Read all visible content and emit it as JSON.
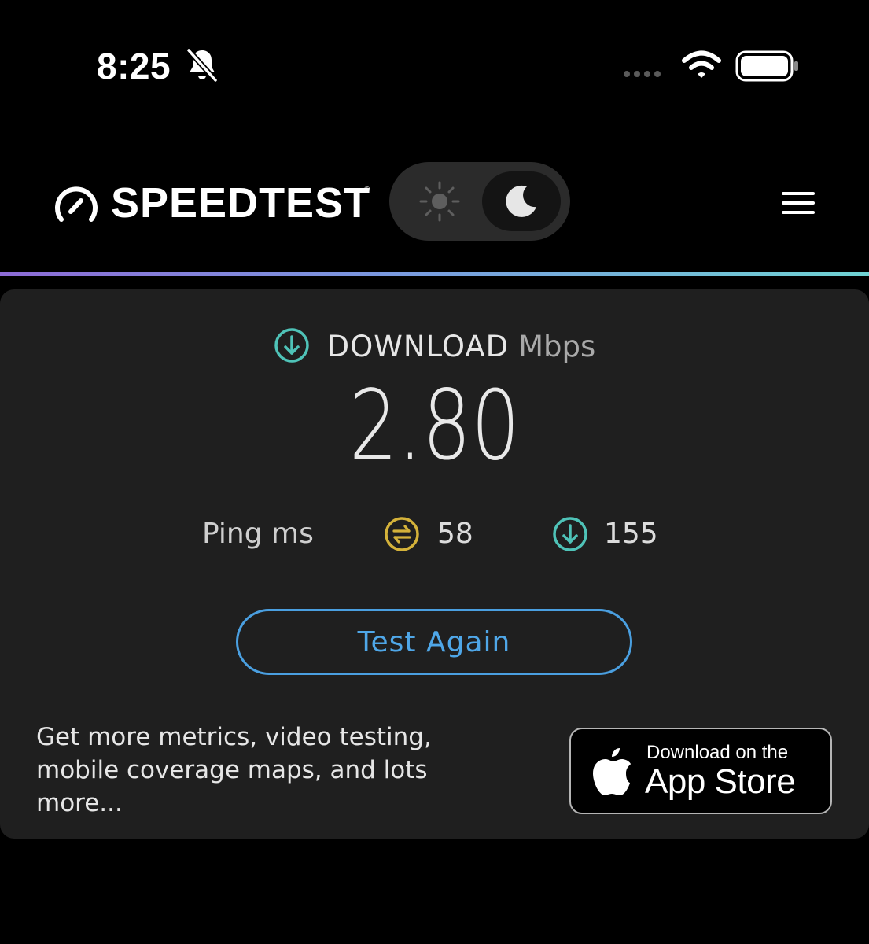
{
  "status_bar": {
    "time": "8:25",
    "icons": [
      "bell-slash-icon",
      "cellular-dots-icon",
      "wifi-icon",
      "battery-icon"
    ]
  },
  "header": {
    "brand": "SPEEDTEST",
    "brand_mark": "®",
    "theme_toggle": {
      "options": [
        "light",
        "dark"
      ],
      "selected": "dark"
    },
    "menu_icon": "hamburger-menu-icon"
  },
  "result": {
    "metric_label": "DOWNLOAD",
    "unit": "Mbps",
    "value": "2.80",
    "ping": {
      "label": "Ping ms",
      "idle_value": "58",
      "download_value": "155"
    },
    "test_again_label": "Test Again"
  },
  "promo": {
    "text": "Get more metrics, video testing, mobile coverage maps, and lots more...",
    "app_store": {
      "small_text": "Download on the",
      "large_text": "App Store"
    }
  },
  "colors": {
    "background": "#000000",
    "card": "#1f1f1f",
    "download_accent": "#4fc3b8",
    "jitter_accent": "#d4b23a",
    "button_accent": "#4a9fe0"
  }
}
